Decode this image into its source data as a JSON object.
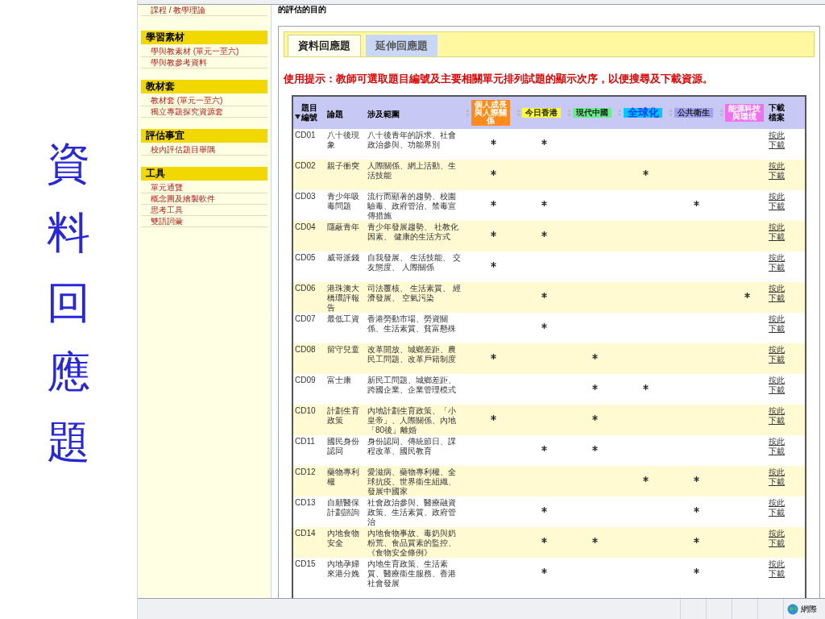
{
  "slide": {
    "title": "資料回應題"
  },
  "browser": {
    "top_text": "的評估的目的",
    "status_text": "網際"
  },
  "sidebar": {
    "top_item": "課程 / 教學理論",
    "sections": [
      {
        "title": "學習素材",
        "items": [
          "學與教素材 (單元一至六)",
          "學與教參考資料"
        ]
      },
      {
        "title": "教材套",
        "items": [
          "教材套 (單元一至六)",
          "獨立專題探究資源套"
        ]
      },
      {
        "title": "評估事宜",
        "items": [
          "校內評估題目舉隅"
        ]
      },
      {
        "title": "工具",
        "items": [
          "單元通覽",
          "概念圖及繪製軟件",
          "思考工具",
          "雙語詞彙"
        ]
      }
    ]
  },
  "tabs": [
    {
      "label": "資料回應題",
      "selected": true
    },
    {
      "label": "延伸回應題",
      "selected": false
    }
  ],
  "hint": "使用提示：教師可選取題目編號及主要相關單元排列試題的顯示次序，以便搜尋及下載資源。",
  "table": {
    "code_header": "題目編號",
    "topic_header": "論題",
    "scope_header": "涉及範圍",
    "download_header": "下載檔案",
    "categories": [
      {
        "label": "個人成長與人際關係",
        "color": "#ff8c1a"
      },
      {
        "label": "今日香港",
        "color": "#ffff33"
      },
      {
        "label": "現代中國",
        "color": "#66ee88"
      },
      {
        "label": "全球化",
        "color": "#00c8ff"
      },
      {
        "label": "公共衛生",
        "color": "#a0a0f0"
      },
      {
        "label": "能源科技與環境",
        "color": "#f070f0"
      }
    ],
    "rows": [
      {
        "code": "CD01",
        "topic": "八十後現象",
        "scope": "八十後青年的訴求、社會政治參與、功能界別",
        "marks": [
          true,
          true,
          false,
          false,
          false,
          false
        ],
        "download": "按此下載"
      },
      {
        "code": "CD02",
        "topic": "親子衝突",
        "scope": "人際關係、網上活動、生活技能",
        "marks": [
          true,
          false,
          false,
          true,
          false,
          false
        ],
        "download": "按此下載"
      },
      {
        "code": "CD03",
        "topic": "青少年吸毒問題",
        "scope": "流行而顯著的趨勢、校園驗毒、政府管治、禁毒宣傳措施",
        "marks": [
          true,
          true,
          false,
          false,
          true,
          false
        ],
        "download": "按此下載"
      },
      {
        "code": "CD04",
        "topic": "隱蔽青年",
        "scope": "青少年發展趨勢、 社教化因素、 健康的生活方式",
        "marks": [
          true,
          true,
          false,
          false,
          false,
          false
        ],
        "download": "按此下載"
      },
      {
        "code": "CD05",
        "topic": "威哥派錢",
        "scope": "自我發展、 生活技能、 交友態度、 人際關係",
        "marks": [
          true,
          false,
          false,
          false,
          false,
          false
        ],
        "download": "按此下載"
      },
      {
        "code": "CD06",
        "topic": "港珠澳大橋環評報告",
        "scope": "司法覆核、 生活素質、 經濟發展、 空氣污染",
        "marks": [
          false,
          true,
          false,
          false,
          false,
          true
        ],
        "download": "按此下載"
      },
      {
        "code": "CD07",
        "topic": "最低工資",
        "scope": "香港勞動市場、勞資關係、生活素質、貧富懸殊",
        "marks": [
          false,
          true,
          false,
          false,
          false,
          false
        ],
        "download": "按此下載"
      },
      {
        "code": "CD08",
        "topic": "留守兒童",
        "scope": "改革開放、城鄉差距、農民工問題、改革戶籍制度",
        "marks": [
          true,
          false,
          true,
          false,
          false,
          false
        ],
        "download": "按此下載"
      },
      {
        "code": "CD09",
        "topic": "富士康",
        "scope": "新民工問題、城鄉差距、跨國企業、企業管理模式",
        "marks": [
          false,
          false,
          true,
          true,
          false,
          false
        ],
        "download": "按此下載"
      },
      {
        "code": "CD10",
        "topic": "計劃生育政策",
        "scope": "內地計劃生育政策、「小皇帝」、人際關係、內地「80後」離婚",
        "marks": [
          true,
          false,
          true,
          false,
          false,
          false
        ],
        "download": "按此下載"
      },
      {
        "code": "CD11",
        "topic": "國民身份認同",
        "scope": "身份認同、傳統節日、課程改革、國民教育",
        "marks": [
          false,
          true,
          true,
          false,
          false,
          false
        ],
        "download": "按此下載"
      },
      {
        "code": "CD12",
        "topic": "藥物專利權",
        "scope": "愛滋病、藥物專利權、全球抗疫、世界衞生組織、發展中國家",
        "marks": [
          false,
          false,
          false,
          true,
          true,
          false
        ],
        "download": "按此下載"
      },
      {
        "code": "CD13",
        "topic": "自願醫保計劃諮詢",
        "scope": "社會政治參與、醫療融資政策、生活素質、政府管治",
        "marks": [
          false,
          true,
          false,
          false,
          true,
          false
        ],
        "download": "按此下載"
      },
      {
        "code": "CD14",
        "topic": "內地食物安全",
        "scope": "內地食物事故、毒奶與奶粉荒、食品質素的監控、《食物安全條例》",
        "marks": [
          false,
          true,
          true,
          false,
          true,
          false
        ],
        "download": "按此下載"
      },
      {
        "code": "CD15",
        "topic": "內地孕婦來港分娩",
        "scope": "內地生育政策、生活素質、醫療衞生服務、香港社會發展",
        "marks": [
          false,
          true,
          false,
          false,
          true,
          false
        ],
        "download": "按此下載"
      }
    ]
  }
}
